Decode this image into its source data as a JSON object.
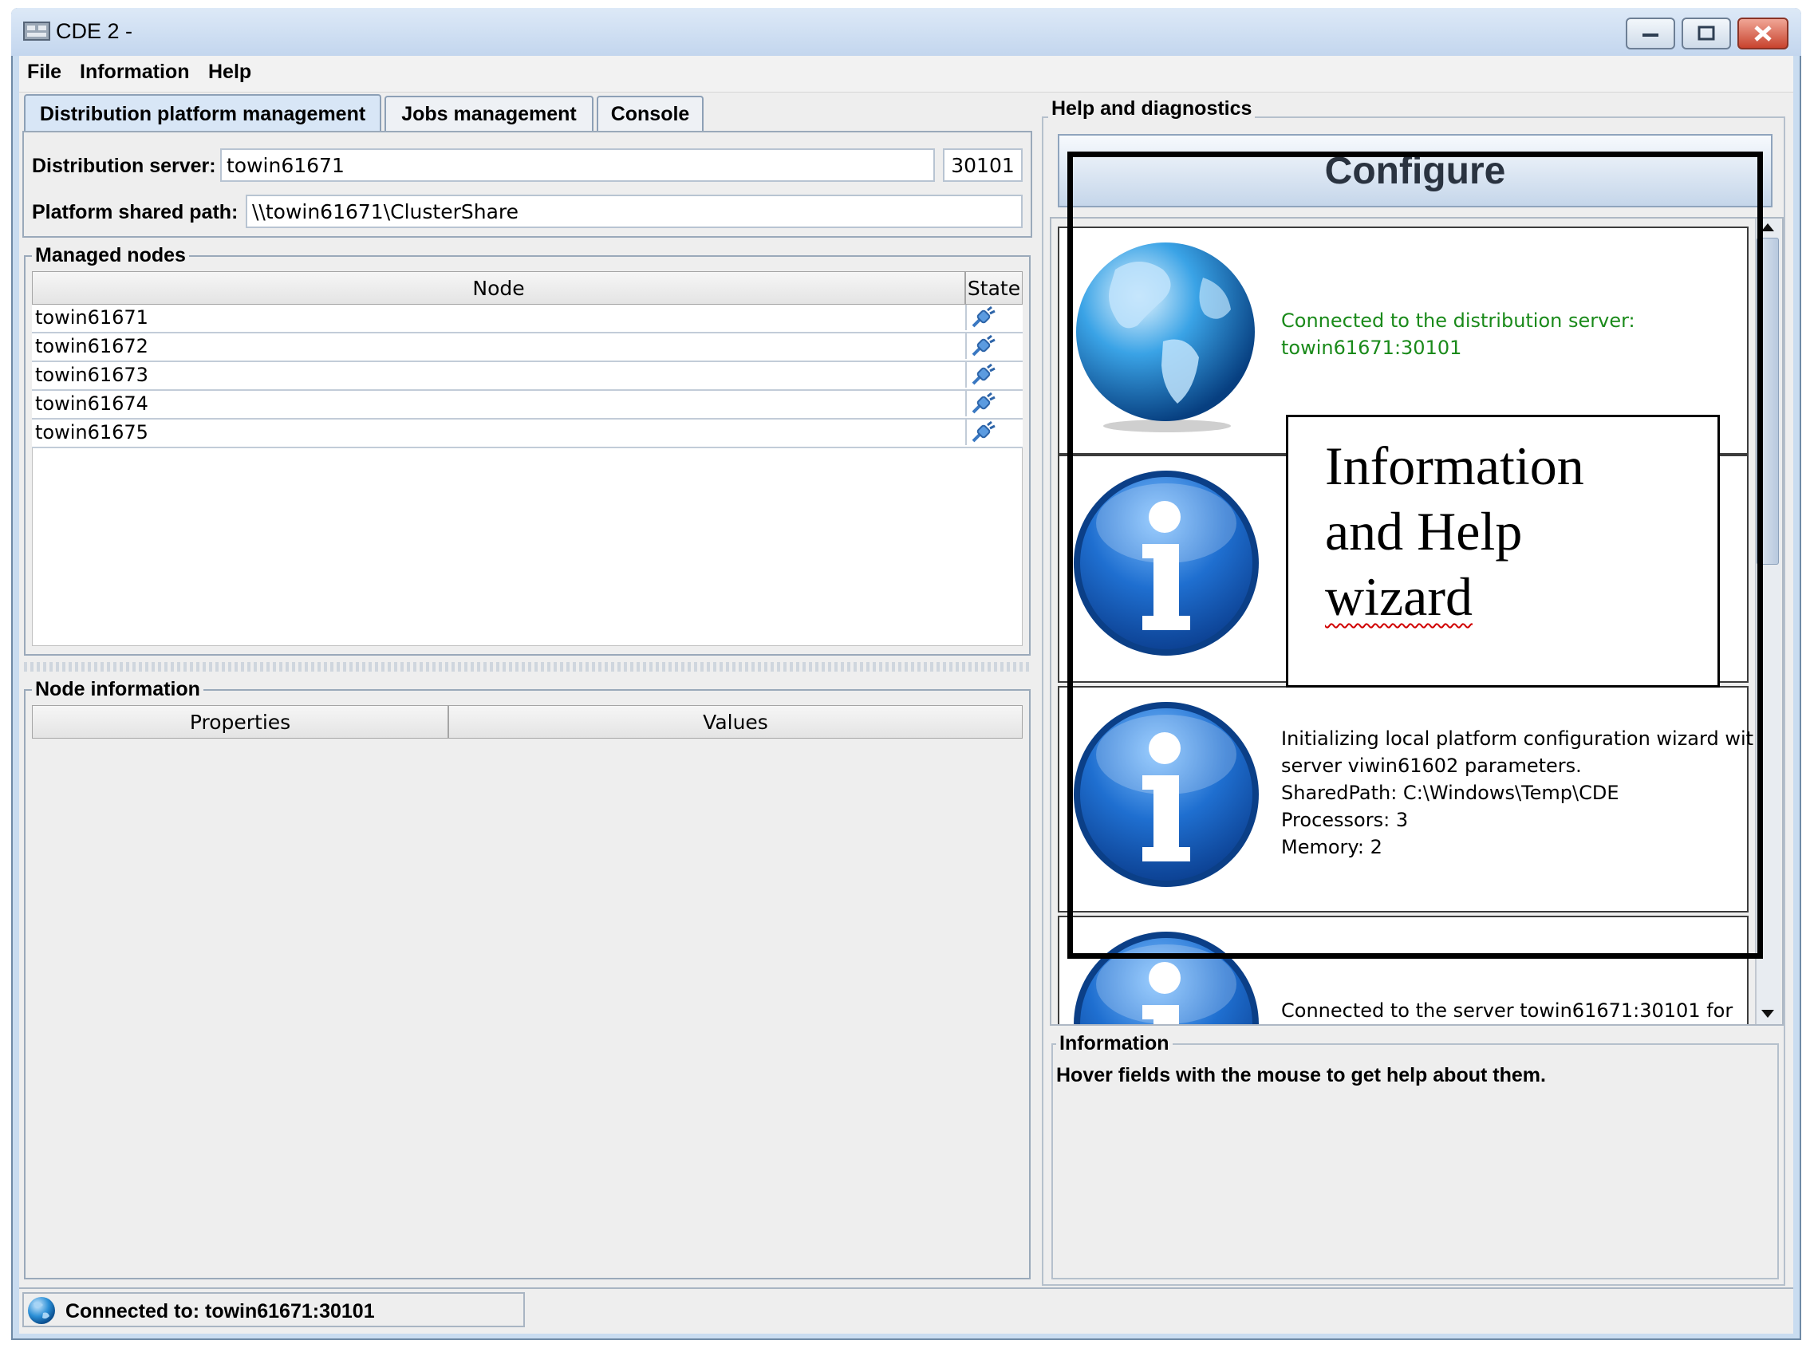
{
  "window": {
    "title": "CDE 2 -"
  },
  "menu": [
    "File",
    "Information",
    "Help"
  ],
  "tabs": [
    "Distribution platform management",
    "Jobs management",
    "Console"
  ],
  "server": {
    "label": "Distribution server:",
    "host": "towin61671",
    "port": "30101",
    "shared_label": "Platform shared path:",
    "shared_path": "\\\\towin61671\\ClusterShare"
  },
  "managed_nodes": {
    "title": "Managed nodes",
    "columns": [
      "Node",
      "State"
    ],
    "rows": [
      "towin61671",
      "towin61672",
      "towin61673",
      "towin61674",
      "towin61675"
    ]
  },
  "node_info": {
    "title": "Node information",
    "columns": [
      "Properties",
      "Values"
    ]
  },
  "help": {
    "title": "Help and diagnostics",
    "configure_label": "Configure",
    "cards": [
      {
        "icon": "globe-icon",
        "color": "#1a8a1a",
        "lines": [
          "Connected to the distribution server:",
          "towin61671:30101"
        ]
      },
      {
        "icon": "info-icon",
        "lines": []
      },
      {
        "icon": "info-icon",
        "lines": [
          "Initializing local platform configuration wizard with",
          "server viwin61602 parameters.",
          "SharedPath: C:\\Windows\\Temp\\CDE",
          "Processors: 3",
          "Memory: 2"
        ]
      },
      {
        "icon": "info-icon",
        "lines": [
          "Connected to the server towin61671:30101 for"
        ]
      }
    ],
    "information_title": "Information",
    "information_text": "Hover fields with the mouse to get help about them."
  },
  "annotation": {
    "lines": [
      "Information",
      "and Help",
      "wizard"
    ]
  },
  "status": {
    "text": "Connected to: towin61671:30101"
  }
}
